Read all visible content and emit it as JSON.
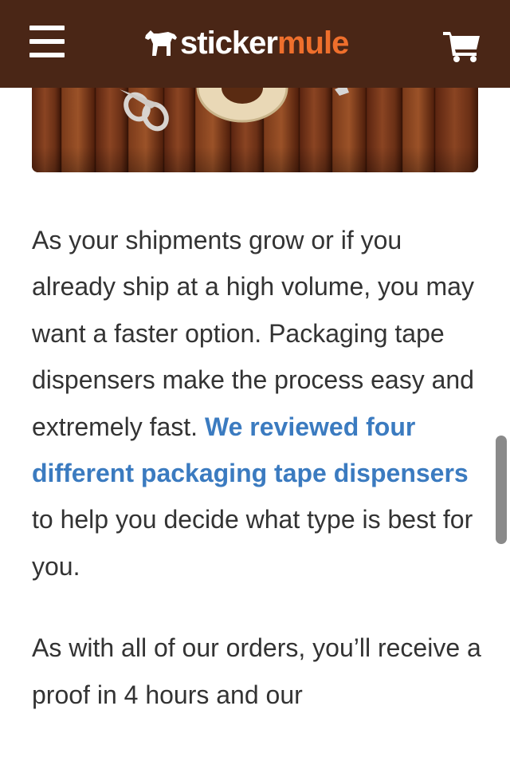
{
  "header": {
    "logo": {
      "part1": "sticker",
      "part2": "mule"
    },
    "icons": {
      "menu": "hamburger-menu-icon",
      "logo_mark": "mule-icon",
      "cart": "shopping-cart-icon"
    },
    "colors": {
      "background": "#4a2616",
      "logo_accent": "#ef6f2c"
    }
  },
  "article": {
    "paragraph1": {
      "text_before": "As your shipments grow or if you already ship at a high volume, you may want a faster option. Packaging tape dispensers make the process easy and extremely fast. ",
      "link_text": "We reviewed four different packaging tape dispensers",
      "text_after": " to help you decide what type is best for you."
    },
    "paragraph2": {
      "text": "As with all of our orders, you’ll receive a proof in 4 hours and our"
    },
    "colors": {
      "text": "#333333",
      "link": "#3b7bc0"
    }
  }
}
